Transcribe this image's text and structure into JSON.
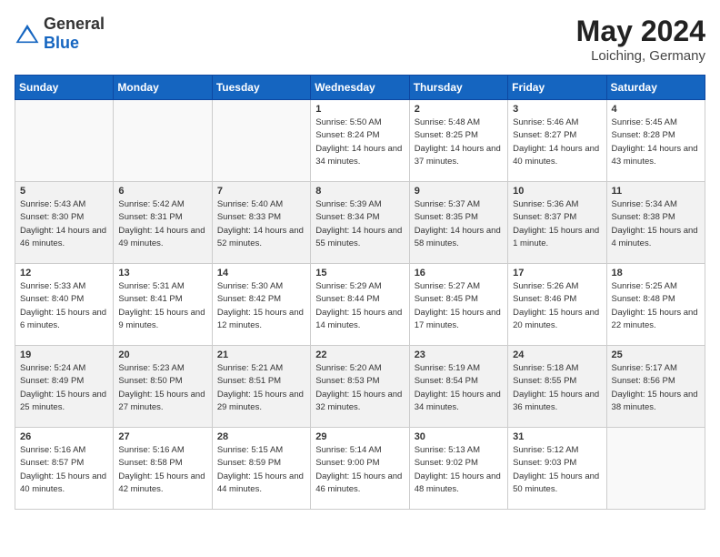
{
  "header": {
    "logo_general": "General",
    "logo_blue": "Blue",
    "month": "May 2024",
    "location": "Loiching, Germany"
  },
  "weekdays": [
    "Sunday",
    "Monday",
    "Tuesday",
    "Wednesday",
    "Thursday",
    "Friday",
    "Saturday"
  ],
  "weeks": [
    [
      {
        "day": "",
        "empty": true
      },
      {
        "day": "",
        "empty": true
      },
      {
        "day": "",
        "empty": true
      },
      {
        "day": "1",
        "sunrise": "5:50 AM",
        "sunset": "8:24 PM",
        "daylight": "14 hours and 34 minutes."
      },
      {
        "day": "2",
        "sunrise": "5:48 AM",
        "sunset": "8:25 PM",
        "daylight": "14 hours and 37 minutes."
      },
      {
        "day": "3",
        "sunrise": "5:46 AM",
        "sunset": "8:27 PM",
        "daylight": "14 hours and 40 minutes."
      },
      {
        "day": "4",
        "sunrise": "5:45 AM",
        "sunset": "8:28 PM",
        "daylight": "14 hours and 43 minutes."
      }
    ],
    [
      {
        "day": "5",
        "sunrise": "5:43 AM",
        "sunset": "8:30 PM",
        "daylight": "14 hours and 46 minutes."
      },
      {
        "day": "6",
        "sunrise": "5:42 AM",
        "sunset": "8:31 PM",
        "daylight": "14 hours and 49 minutes."
      },
      {
        "day": "7",
        "sunrise": "5:40 AM",
        "sunset": "8:33 PM",
        "daylight": "14 hours and 52 minutes."
      },
      {
        "day": "8",
        "sunrise": "5:39 AM",
        "sunset": "8:34 PM",
        "daylight": "14 hours and 55 minutes."
      },
      {
        "day": "9",
        "sunrise": "5:37 AM",
        "sunset": "8:35 PM",
        "daylight": "14 hours and 58 minutes."
      },
      {
        "day": "10",
        "sunrise": "5:36 AM",
        "sunset": "8:37 PM",
        "daylight": "15 hours and 1 minute."
      },
      {
        "day": "11",
        "sunrise": "5:34 AM",
        "sunset": "8:38 PM",
        "daylight": "15 hours and 4 minutes."
      }
    ],
    [
      {
        "day": "12",
        "sunrise": "5:33 AM",
        "sunset": "8:40 PM",
        "daylight": "15 hours and 6 minutes."
      },
      {
        "day": "13",
        "sunrise": "5:31 AM",
        "sunset": "8:41 PM",
        "daylight": "15 hours and 9 minutes."
      },
      {
        "day": "14",
        "sunrise": "5:30 AM",
        "sunset": "8:42 PM",
        "daylight": "15 hours and 12 minutes."
      },
      {
        "day": "15",
        "sunrise": "5:29 AM",
        "sunset": "8:44 PM",
        "daylight": "15 hours and 14 minutes."
      },
      {
        "day": "16",
        "sunrise": "5:27 AM",
        "sunset": "8:45 PM",
        "daylight": "15 hours and 17 minutes."
      },
      {
        "day": "17",
        "sunrise": "5:26 AM",
        "sunset": "8:46 PM",
        "daylight": "15 hours and 20 minutes."
      },
      {
        "day": "18",
        "sunrise": "5:25 AM",
        "sunset": "8:48 PM",
        "daylight": "15 hours and 22 minutes."
      }
    ],
    [
      {
        "day": "19",
        "sunrise": "5:24 AM",
        "sunset": "8:49 PM",
        "daylight": "15 hours and 25 minutes."
      },
      {
        "day": "20",
        "sunrise": "5:23 AM",
        "sunset": "8:50 PM",
        "daylight": "15 hours and 27 minutes."
      },
      {
        "day": "21",
        "sunrise": "5:21 AM",
        "sunset": "8:51 PM",
        "daylight": "15 hours and 29 minutes."
      },
      {
        "day": "22",
        "sunrise": "5:20 AM",
        "sunset": "8:53 PM",
        "daylight": "15 hours and 32 minutes."
      },
      {
        "day": "23",
        "sunrise": "5:19 AM",
        "sunset": "8:54 PM",
        "daylight": "15 hours and 34 minutes."
      },
      {
        "day": "24",
        "sunrise": "5:18 AM",
        "sunset": "8:55 PM",
        "daylight": "15 hours and 36 minutes."
      },
      {
        "day": "25",
        "sunrise": "5:17 AM",
        "sunset": "8:56 PM",
        "daylight": "15 hours and 38 minutes."
      }
    ],
    [
      {
        "day": "26",
        "sunrise": "5:16 AM",
        "sunset": "8:57 PM",
        "daylight": "15 hours and 40 minutes."
      },
      {
        "day": "27",
        "sunrise": "5:16 AM",
        "sunset": "8:58 PM",
        "daylight": "15 hours and 42 minutes."
      },
      {
        "day": "28",
        "sunrise": "5:15 AM",
        "sunset": "8:59 PM",
        "daylight": "15 hours and 44 minutes."
      },
      {
        "day": "29",
        "sunrise": "5:14 AM",
        "sunset": "9:00 PM",
        "daylight": "15 hours and 46 minutes."
      },
      {
        "day": "30",
        "sunrise": "5:13 AM",
        "sunset": "9:02 PM",
        "daylight": "15 hours and 48 minutes."
      },
      {
        "day": "31",
        "sunrise": "5:12 AM",
        "sunset": "9:03 PM",
        "daylight": "15 hours and 50 minutes."
      },
      {
        "day": "",
        "empty": true
      }
    ]
  ]
}
